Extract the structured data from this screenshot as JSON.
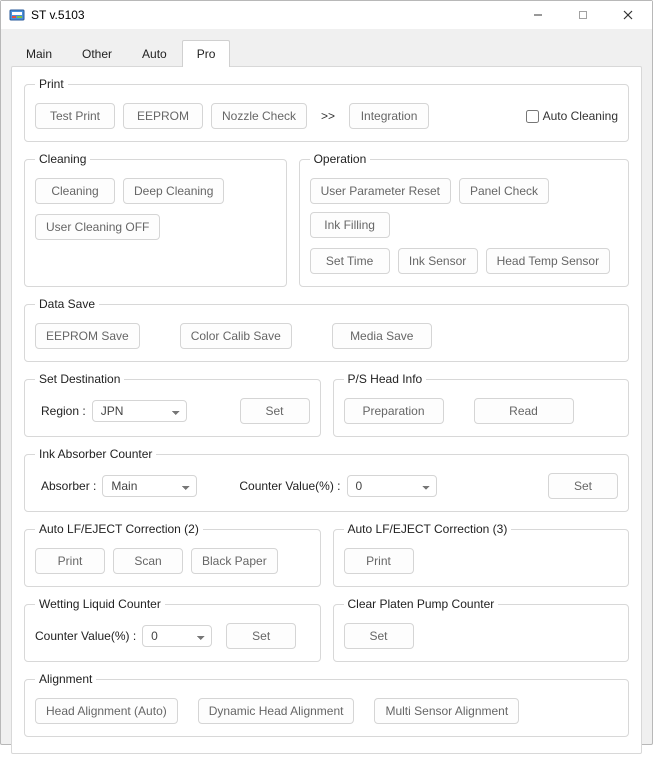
{
  "window": {
    "title": "ST v.5103"
  },
  "tabs": [
    "Main",
    "Other",
    "Auto",
    "Pro"
  ],
  "activeTab": "Pro",
  "print": {
    "legend": "Print",
    "testPrint": "Test Print",
    "eeprom": "EEPROM",
    "nozzle": "Nozzle Check",
    "more": ">>",
    "integration": "Integration",
    "autoCleaning": "Auto Cleaning"
  },
  "cleaning": {
    "legend": "Cleaning",
    "cleaning": "Cleaning",
    "deep": "Deep Cleaning",
    "userOff": "User Cleaning OFF"
  },
  "operation": {
    "legend": "Operation",
    "userParamReset": "User Parameter Reset",
    "panelCheck": "Panel Check",
    "inkFilling": "Ink Filling",
    "setTime": "Set Time",
    "inkSensor": "Ink Sensor",
    "headTemp": "Head Temp Sensor"
  },
  "dataSave": {
    "legend": "Data Save",
    "eepromSave": "EEPROM Save",
    "colorCalib": "Color Calib Save",
    "mediaSave": "Media Save"
  },
  "setDest": {
    "legend": "Set Destination",
    "regionLabel": "Region :",
    "regionValue": "JPN",
    "set": "Set"
  },
  "psHead": {
    "legend": "P/S Head Info",
    "preparation": "Preparation",
    "read": "Read"
  },
  "inkAbs": {
    "legend": "Ink Absorber Counter",
    "absorberLabel": "Absorber :",
    "absorberValue": "Main",
    "counterLabel": "Counter Value(%) :",
    "counterValue": "0",
    "set": "Set"
  },
  "lfEject2": {
    "legend": "Auto LF/EJECT Correction (2)",
    "print": "Print",
    "scan": "Scan",
    "black": "Black Paper"
  },
  "lfEject3": {
    "legend": "Auto LF/EJECT Correction (3)",
    "print": "Print"
  },
  "wetting": {
    "legend": "Wetting Liquid Counter",
    "counterLabel": "Counter Value(%) :",
    "counterValue": "0",
    "set": "Set"
  },
  "platen": {
    "legend": "Clear Platen Pump Counter",
    "set": "Set"
  },
  "alignment": {
    "legend": "Alignment",
    "auto": "Head Alignment (Auto)",
    "dynamic": "Dynamic Head Alignment",
    "multi": "Multi Sensor Alignment"
  }
}
